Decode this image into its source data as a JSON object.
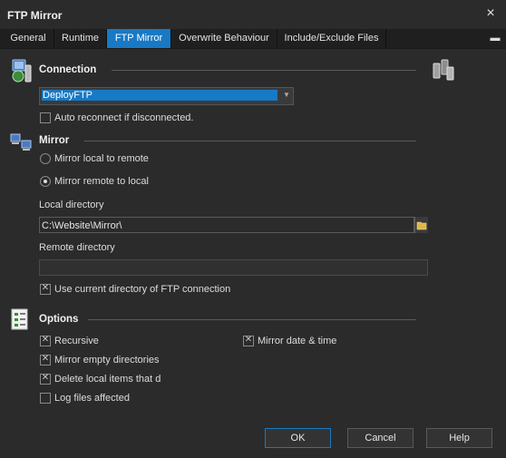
{
  "window": {
    "title": "FTP Mirror",
    "close_label": "×"
  },
  "tabs": [
    {
      "label": "General"
    },
    {
      "label": "Runtime"
    },
    {
      "label": "FTP Mirror"
    },
    {
      "label": "Overwrite Behaviour"
    },
    {
      "label": "Include/Exclude Files"
    }
  ],
  "tabs_menu_label": "▬",
  "connection": {
    "title": "Connection",
    "selected": "DeployFTP",
    "auto_reconnect_label": "Auto reconnect if disconnected.",
    "auto_reconnect_checked": false
  },
  "mirror": {
    "title": "Mirror",
    "option_local_to_remote": "Mirror local to remote",
    "option_remote_to_local": "Mirror remote to local",
    "selected": "remote_to_local",
    "local_dir_label": "Local directory",
    "local_dir_value": "C:\\Website\\Mirror\\",
    "remote_dir_label": "Remote directory",
    "remote_dir_value": "",
    "use_current_dir_label": "Use current directory of FTP connection",
    "use_current_dir_checked": true
  },
  "options": {
    "title": "Options",
    "recursive_label": "Recursive",
    "mirror_empty_label": "Mirror empty directories",
    "delete_local_label": "Delete local items that do not exist remotely",
    "log_files_label": "Log files affected",
    "mirror_date_label": "Mirror date & time"
  },
  "buttons": {
    "ok": "OK",
    "cancel": "Cancel",
    "help": "Help"
  },
  "colors": {
    "accent": "#1879c4",
    "background": "#2b2b2b"
  }
}
